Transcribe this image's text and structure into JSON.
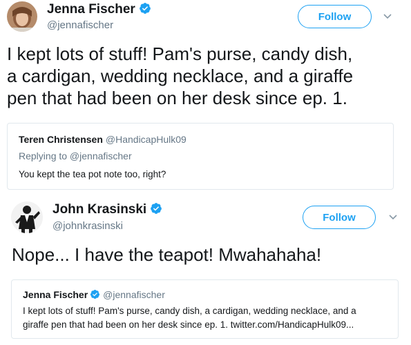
{
  "tweet1": {
    "author_name": "Jenna Fischer",
    "handle": "@jennafischer",
    "follow_label": "Follow",
    "text_lines": [
      "I kept lots of stuff! Pam's purse, candy dish,",
      "a cardigan, wedding necklace, and a giraffe",
      "pen that had been on her desk since ep. 1."
    ]
  },
  "reply_card": {
    "author_name": "Teren Christensen",
    "handle": "@HandicapHulk09",
    "replying_to": "Replying to @jennafischer",
    "text": "You kept the tea pot note too, right?"
  },
  "tweet2": {
    "author_name": "John Krasinski",
    "handle": "@johnkrasinski",
    "follow_label": "Follow",
    "text": "Nope... I have the teapot!  Mwahahaha!"
  },
  "quote_card": {
    "author_name": "Jenna Fischer",
    "handle": "@jennafischer",
    "text_lines": [
      "I kept lots of stuff! Pam's purse, candy dish, a cardigan, wedding necklace, and a",
      "giraffe pen that had been on her desk since ep. 1. twitter.com/HandicapHulk09..."
    ]
  },
  "colors": {
    "accent": "#1da1f2",
    "secondary_text": "#657786",
    "primary_text": "#14171a",
    "border": "#e1e8ed"
  },
  "icons": [
    "verified-badge-icon",
    "chevron-down-icon"
  ]
}
